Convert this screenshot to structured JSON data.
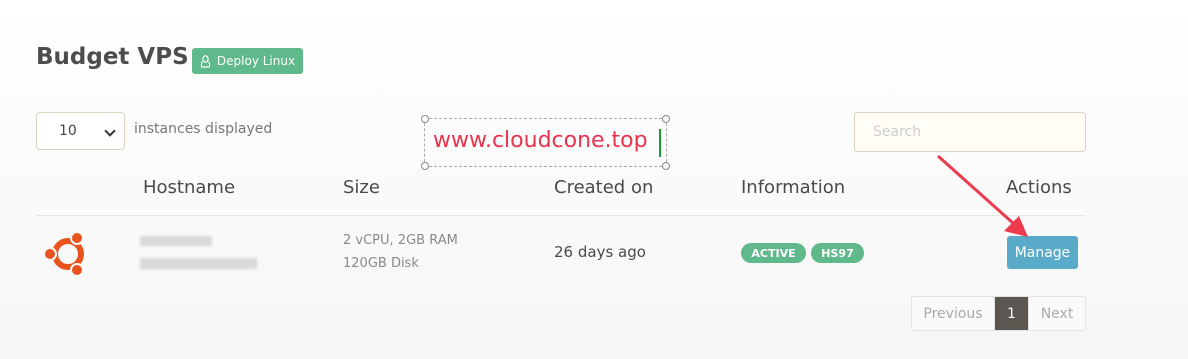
{
  "header": {
    "title": "Budget VPS",
    "deploy_label": "Deploy Linux",
    "deploy_icon": "linux-icon",
    "accent_color": "#5fb98a"
  },
  "controls": {
    "page_length_value": "10",
    "page_length_label": "instances displayed",
    "search_placeholder": "Search"
  },
  "watermark": {
    "text": "www.cloudcone.top"
  },
  "table": {
    "columns": [
      "Hostname",
      "Size",
      "Created on",
      "Information",
      "Actions"
    ],
    "rows": [
      {
        "os_icon": "ubuntu-icon",
        "size_line1": "2 vCPU, 2GB RAM",
        "size_line2": "120GB Disk",
        "created": "26 days ago",
        "badges": [
          "ACTIVE",
          "HS97"
        ],
        "action_label": "Manage"
      }
    ]
  },
  "pagination": {
    "previous": "Previous",
    "current": "1",
    "next": "Next"
  }
}
